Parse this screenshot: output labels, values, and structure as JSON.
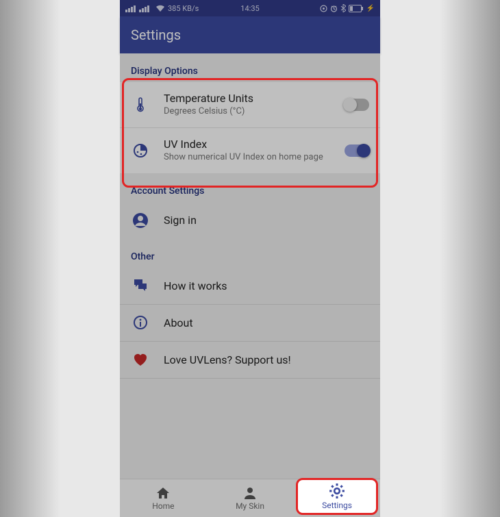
{
  "statusbar": {
    "speed": "385 KB/s",
    "time": "14:35"
  },
  "appbar": {
    "title": "Settings"
  },
  "sections": {
    "display": {
      "header": "Display Options",
      "items": [
        {
          "title": "Temperature Units",
          "subtitle": "Degrees Celsius (°C)",
          "on": false
        },
        {
          "title": "UV Index",
          "subtitle": "Show numerical UV Index on home page",
          "on": true
        }
      ]
    },
    "account": {
      "header": "Account Settings",
      "items": [
        {
          "title": "Sign in"
        }
      ]
    },
    "other": {
      "header": "Other",
      "items": [
        {
          "title": "How it works"
        },
        {
          "title": "About"
        },
        {
          "title": "Love UVLens? Support us!"
        }
      ]
    }
  },
  "bottomnav": {
    "items": [
      {
        "label": "Home"
      },
      {
        "label": "My Skin"
      },
      {
        "label": "Settings"
      }
    ]
  }
}
